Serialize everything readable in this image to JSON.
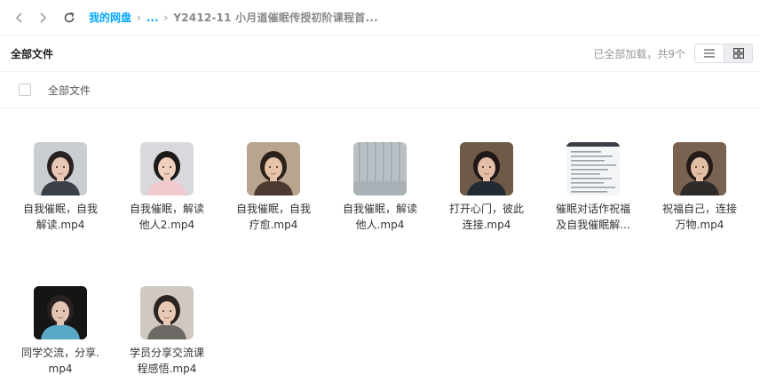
{
  "breadcrumb": {
    "root": "我的网盘",
    "ellipsis": "...",
    "current": "Y2412-11 小月道催眠传授初阶课程首..."
  },
  "toolbar": {
    "title": "全部文件",
    "load_status": "已全部加载，共9个"
  },
  "select_row": {
    "label": "全部文件"
  },
  "files": [
    {
      "line1": "自我催眠，自我",
      "line2": "解读.mp4",
      "scene": "face",
      "bg": "#c9ced2",
      "skin": "#e8c7b4",
      "hair": "#2a2220",
      "shirt": "#3b3f46"
    },
    {
      "line1": "自我催眠，解读",
      "line2": "他人2.mp4",
      "scene": "face",
      "bg": "#d9d8dc",
      "skin": "#efcfbd",
      "hair": "#1f1a1a",
      "shirt": "#f2c9cf"
    },
    {
      "line1": "自我催眠，自我",
      "line2": "疗愈.mp4",
      "scene": "face",
      "bg": "#b9a58e",
      "skin": "#e6c3a9",
      "hair": "#2d211b",
      "shirt": "#4a3a30"
    },
    {
      "line1": "自我催眠，解读",
      "line2": "他人.mp4",
      "scene": "blinds",
      "bg": "#b8c0c5",
      "skin": "",
      "hair": "",
      "shirt": ""
    },
    {
      "line1": "打开心门，彼此",
      "line2": "连接.mp4",
      "scene": "face",
      "bg": "#6e5a46",
      "skin": "#e4bea6",
      "hair": "#201818",
      "shirt": "#222a34"
    },
    {
      "line1": "催眠对话作祝福",
      "line2": "及自我催眠解...",
      "scene": "doc",
      "bg": "#f4f5f7",
      "skin": "",
      "hair": "",
      "shirt": ""
    },
    {
      "line1": "祝福自己，连接",
      "line2": "万物.mp4",
      "scene": "face",
      "bg": "#7a6250",
      "skin": "#e3bfa6",
      "hair": "#241b18",
      "shirt": "#2e2a28"
    },
    {
      "line1": "同学交流，分享.",
      "line2": "mp4",
      "scene": "face-dark",
      "bg": "#151515",
      "skin": "#e2c4b3",
      "hair": "#2a2020",
      "shirt": "#5aa8c8"
    },
    {
      "line1": "学员分享交流课",
      "line2": "程感悟.mp4",
      "scene": "face",
      "bg": "#cfc9c2",
      "skin": "#e8c9b5",
      "hair": "#2b2320",
      "shirt": "#6d6a66"
    }
  ]
}
